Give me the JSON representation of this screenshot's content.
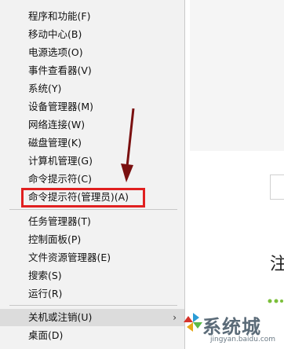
{
  "menu": {
    "items": [
      {
        "label": "程序和功能(F)",
        "name": "menu-item-programs-features"
      },
      {
        "label": "移动中心(B)",
        "name": "menu-item-mobility-center"
      },
      {
        "label": "电源选项(O)",
        "name": "menu-item-power-options"
      },
      {
        "label": "事件查看器(V)",
        "name": "menu-item-event-viewer"
      },
      {
        "label": "系统(Y)",
        "name": "menu-item-system"
      },
      {
        "label": "设备管理器(M)",
        "name": "menu-item-device-manager"
      },
      {
        "label": "网络连接(W)",
        "name": "menu-item-network-connections"
      },
      {
        "label": "磁盘管理(K)",
        "name": "menu-item-disk-management"
      },
      {
        "label": "计算机管理(G)",
        "name": "menu-item-computer-management"
      },
      {
        "label": "命令提示符(C)",
        "name": "menu-item-command-prompt"
      },
      {
        "label": "命令提示符(管理员)(A)",
        "name": "menu-item-command-prompt-admin"
      },
      {
        "label": "任务管理器(T)",
        "name": "menu-item-task-manager"
      },
      {
        "label": "控制面板(P)",
        "name": "menu-item-control-panel"
      },
      {
        "label": "文件资源管理器(E)",
        "name": "menu-item-file-explorer"
      },
      {
        "label": "搜索(S)",
        "name": "menu-item-search"
      },
      {
        "label": "运行(R)",
        "name": "menu-item-run"
      },
      {
        "label": "关机或注销(U)",
        "name": "menu-item-shutdown-signout"
      },
      {
        "label": "桌面(D)",
        "name": "menu-item-desktop"
      }
    ],
    "submenu_glyph": "›"
  },
  "right_panel": {
    "partial_text": "注"
  },
  "watermark": {
    "main": "系统城",
    "sub": "jingyan.baidu.com"
  },
  "colors": {
    "highlight_box": "#e02020",
    "arrow": "#7a1010"
  }
}
